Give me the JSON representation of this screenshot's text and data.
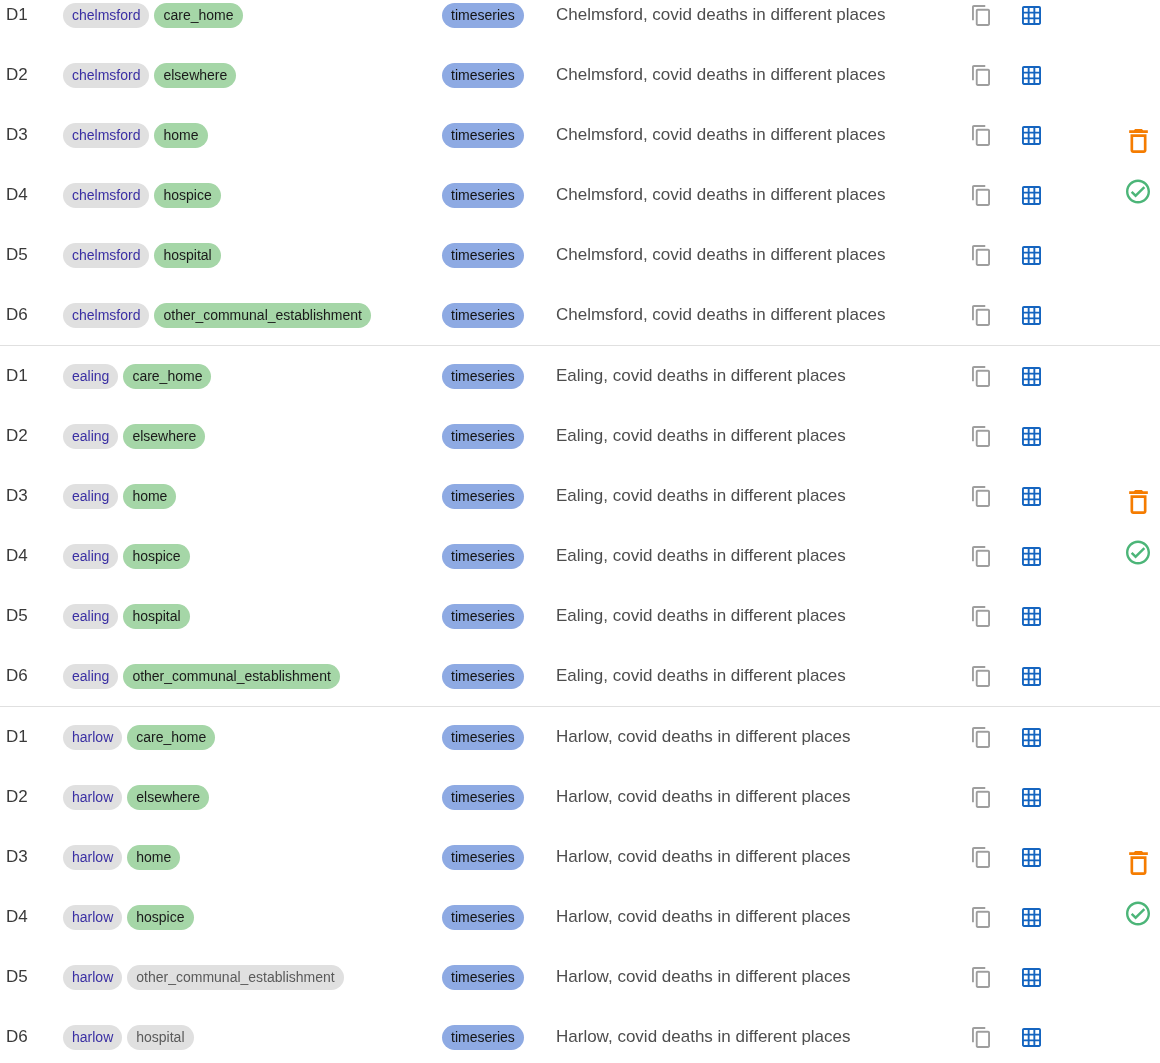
{
  "groups": [
    {
      "rows": [
        {
          "id": "D1",
          "area": "chelmsford",
          "place": {
            "label": "care_home",
            "highlighted": true
          },
          "type": "timeseries",
          "title": "Chelmsford, covid deaths in different places",
          "kind": "plain"
        },
        {
          "id": "D2",
          "area": "chelmsford",
          "place": {
            "label": "elsewhere",
            "highlighted": true
          },
          "type": "timeseries",
          "title": "Chelmsford, covid deaths in different places",
          "kind": "plain"
        },
        {
          "id": "D3",
          "area": "chelmsford",
          "place": {
            "label": "home",
            "highlighted": true
          },
          "type": "timeseries",
          "title": "Chelmsford, covid deaths in different places",
          "kind": "delete"
        },
        {
          "id": "D4",
          "area": "chelmsford",
          "place": {
            "label": "hospice",
            "highlighted": true
          },
          "type": "timeseries",
          "title": "Chelmsford, covid deaths in different places",
          "kind": "check"
        },
        {
          "id": "D5",
          "area": "chelmsford",
          "place": {
            "label": "hospital",
            "highlighted": true
          },
          "type": "timeseries",
          "title": "Chelmsford, covid deaths in different places",
          "kind": "plain"
        },
        {
          "id": "D6",
          "area": "chelmsford",
          "place": {
            "label": "other_communal_establishment",
            "highlighted": true
          },
          "type": "timeseries",
          "title": "Chelmsford, covid deaths in different places",
          "kind": "plain"
        }
      ]
    },
    {
      "rows": [
        {
          "id": "D1",
          "area": "ealing",
          "place": {
            "label": "care_home",
            "highlighted": true
          },
          "type": "timeseries",
          "title": "Ealing, covid deaths in different places",
          "kind": "plain"
        },
        {
          "id": "D2",
          "area": "ealing",
          "place": {
            "label": "elsewhere",
            "highlighted": true
          },
          "type": "timeseries",
          "title": "Ealing, covid deaths in different places",
          "kind": "plain"
        },
        {
          "id": "D3",
          "area": "ealing",
          "place": {
            "label": "home",
            "highlighted": true
          },
          "type": "timeseries",
          "title": "Ealing, covid deaths in different places",
          "kind": "delete"
        },
        {
          "id": "D4",
          "area": "ealing",
          "place": {
            "label": "hospice",
            "highlighted": true
          },
          "type": "timeseries",
          "title": "Ealing, covid deaths in different places",
          "kind": "check"
        },
        {
          "id": "D5",
          "area": "ealing",
          "place": {
            "label": "hospital",
            "highlighted": true
          },
          "type": "timeseries",
          "title": "Ealing, covid deaths in different places",
          "kind": "plain"
        },
        {
          "id": "D6",
          "area": "ealing",
          "place": {
            "label": "other_communal_establishment",
            "highlighted": true
          },
          "type": "timeseries",
          "title": "Ealing, covid deaths in different places",
          "kind": "plain"
        }
      ]
    },
    {
      "rows": [
        {
          "id": "D1",
          "area": "harlow",
          "place": {
            "label": "care_home",
            "highlighted": true
          },
          "type": "timeseries",
          "title": "Harlow, covid deaths in different places",
          "kind": "plain"
        },
        {
          "id": "D2",
          "area": "harlow",
          "place": {
            "label": "elsewhere",
            "highlighted": true
          },
          "type": "timeseries",
          "title": "Harlow, covid deaths in different places",
          "kind": "plain"
        },
        {
          "id": "D3",
          "area": "harlow",
          "place": {
            "label": "home",
            "highlighted": true
          },
          "type": "timeseries",
          "title": "Harlow, covid deaths in different places",
          "kind": "delete"
        },
        {
          "id": "D4",
          "area": "harlow",
          "place": {
            "label": "hospice",
            "highlighted": true
          },
          "type": "timeseries",
          "title": "Harlow, covid deaths in different places",
          "kind": "check"
        },
        {
          "id": "D5",
          "area": "harlow",
          "place": {
            "label": "other_communal_establishment",
            "highlighted": false
          },
          "type": "timeseries",
          "title": "Harlow, covid deaths in different places",
          "kind": "plain"
        },
        {
          "id": "D6",
          "area": "harlow",
          "place": {
            "label": "hospital",
            "highlighted": false
          },
          "type": "timeseries",
          "title": "Harlow, covid deaths in different places",
          "kind": "plain"
        }
      ]
    }
  ]
}
